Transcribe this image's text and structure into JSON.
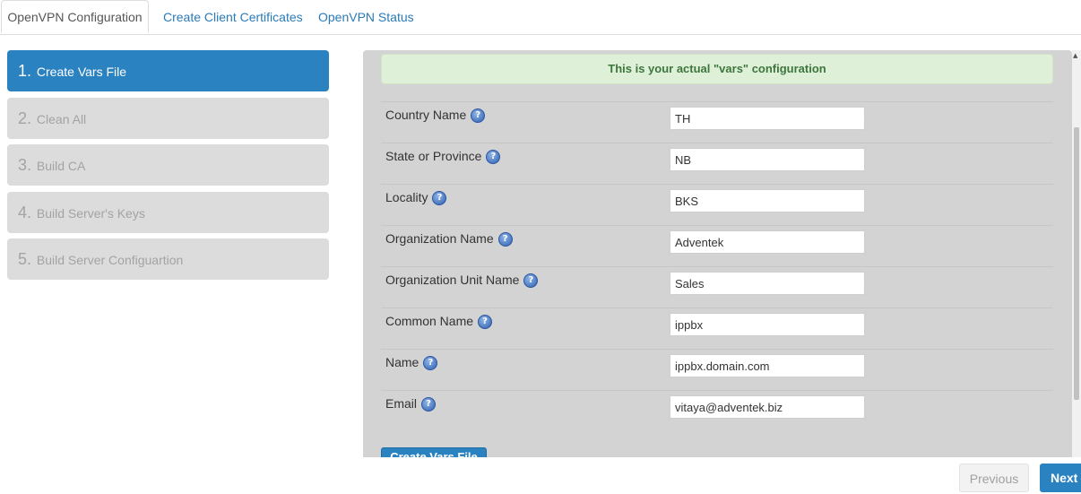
{
  "tabs": [
    {
      "label": "OpenVPN Configuration"
    },
    {
      "label": "Create Client Certificates"
    },
    {
      "label": "OpenVPN Status"
    }
  ],
  "steps": [
    {
      "num": "1.",
      "label": "Create Vars File"
    },
    {
      "num": "2.",
      "label": "Clean All"
    },
    {
      "num": "3.",
      "label": "Build CA"
    },
    {
      "num": "4.",
      "label": "Build Server's Keys"
    },
    {
      "num": "5.",
      "label": "Build Server Configuartion"
    }
  ],
  "alert": "This is your actual \"vars\" configuration",
  "help_icon": "question-mark-icon",
  "fields": [
    {
      "label": "Country Name",
      "value": "TH"
    },
    {
      "label": "State or Province",
      "value": "NB"
    },
    {
      "label": "Locality",
      "value": "BKS"
    },
    {
      "label": "Organization Name",
      "value": "Adventek"
    },
    {
      "label": "Organization Unit Name",
      "value": "Sales"
    },
    {
      "label": "Common Name",
      "value": "ippbx"
    },
    {
      "label": "Name",
      "value": "ippbx.domain.com"
    },
    {
      "label": "Email",
      "value": "vitaya@adventek.biz"
    }
  ],
  "create_button": "Create Vars File",
  "nav": {
    "previous": "Previous",
    "next": "Next"
  },
  "colors": {
    "accent": "#2b82c0",
    "alert_bg": "#dff0d8",
    "alert_text": "#3c763d",
    "panel_bg": "#d3d3d3"
  }
}
